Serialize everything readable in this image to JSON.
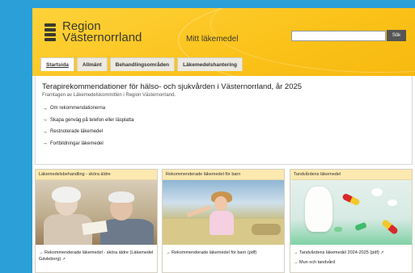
{
  "header": {
    "logo_line1": "Region",
    "logo_line2": "Västernorrland",
    "site_title": "Mitt läkemedel",
    "search_value": "",
    "search_button": "Sök"
  },
  "tabs": [
    {
      "label": "Startsida",
      "active": true
    },
    {
      "label": "Allmänt",
      "active": false
    },
    {
      "label": "Behandlingsområden",
      "active": false
    },
    {
      "label": "Läkemedelshantering",
      "active": false
    }
  ],
  "intro": {
    "title": "Terapirekommendationer för hälso- och sjukvården i Västernorrland, år 2025",
    "subtitle": "Framtagen av Läkemedelskommittén i Region Västernorrland.",
    "links": [
      "Om rekommendationerna",
      "Skapa genväg på telefon eller läsplatta",
      "Restnoterade läkemedel",
      "Fortbildningar läkemedel"
    ]
  },
  "cards": [
    {
      "title": "Läkemedelsbehandling - sköra äldre",
      "links": [
        {
          "text": "Rekommenderade läkemedel - sköra äldre (Läkemedel Gävleborg)",
          "external": true
        }
      ]
    },
    {
      "title": "Rekommenderade läkemedel för barn",
      "links": [
        {
          "text": "Rekommenderade läkemedel för barn (pdf)",
          "external": false
        }
      ]
    },
    {
      "title": "Tandvårdens läkemedel",
      "links": [
        {
          "text": "Tandvårdens läkemedel 2024-2025 (pdf)",
          "external": true
        },
        {
          "text": "Mun och tandvård",
          "external": false
        }
      ]
    }
  ],
  "colors": {
    "background": "#2a9fd8",
    "header_yellow": "#fbc21a",
    "card_header": "#fce9b0"
  },
  "icons": {
    "arrow": "→",
    "external": "↗"
  }
}
